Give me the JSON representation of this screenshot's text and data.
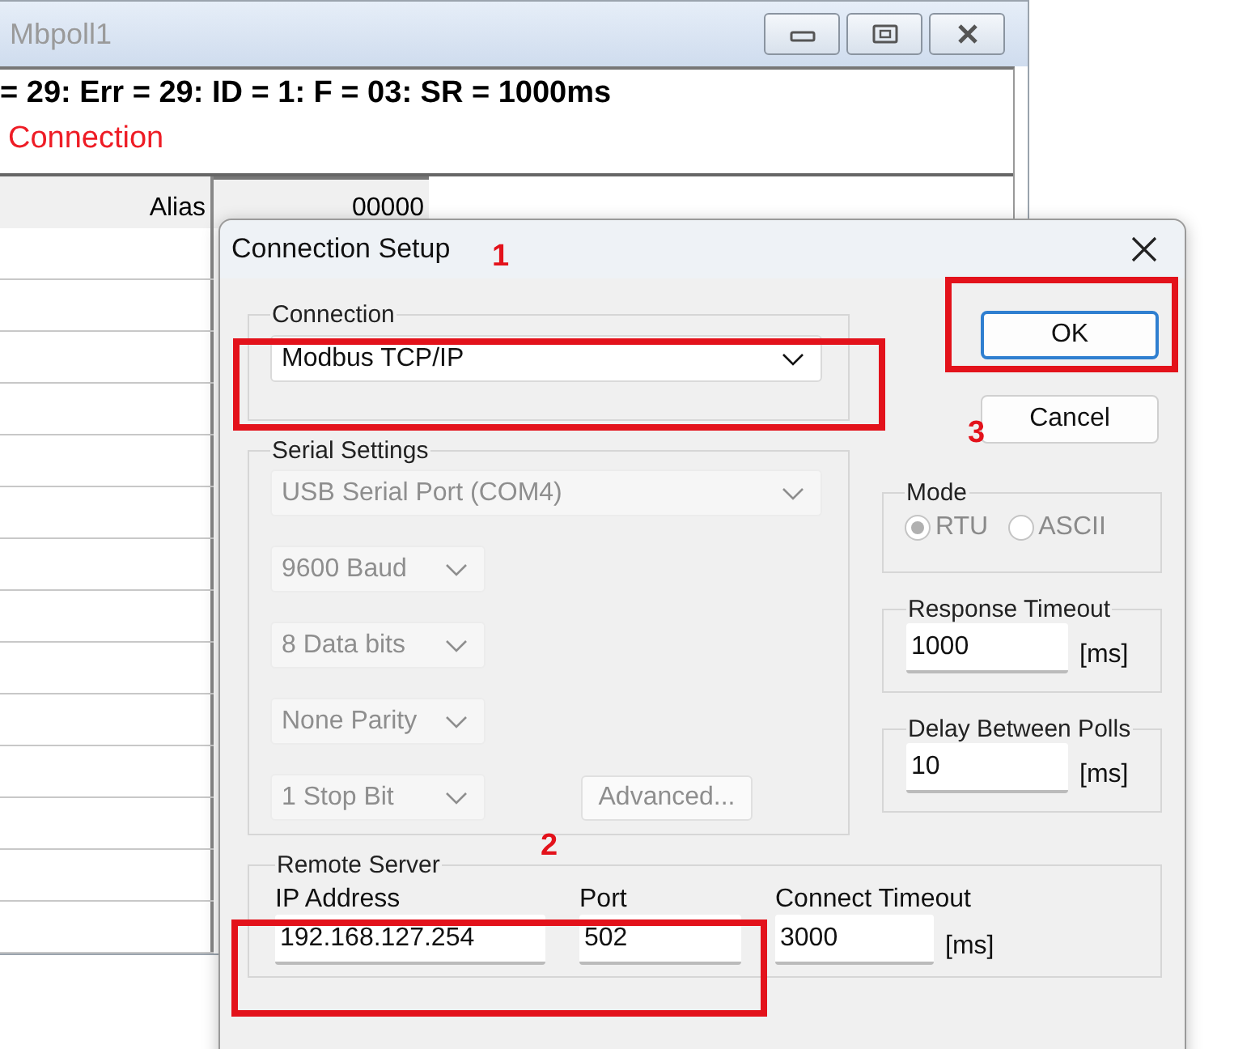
{
  "window": {
    "title": "Mbpoll1",
    "status_line": "= 29: Err = 29: ID = 1: F = 03: SR = 1000ms",
    "error_text": "Connection",
    "table": {
      "columns": [
        "Alias",
        "00000"
      ]
    }
  },
  "dialog": {
    "title": "Connection Setup",
    "connection": {
      "label": "Connection",
      "value": "Modbus TCP/IP",
      "disabled": false
    },
    "serial_settings": {
      "label": "Serial Settings",
      "selects": [
        {
          "kind": "wide",
          "value": "USB Serial Port (COM4)",
          "disabled": true
        },
        {
          "kind": "narrow",
          "value": "9600 Baud",
          "disabled": true
        },
        {
          "kind": "narrow",
          "value": "8 Data bits",
          "disabled": true
        },
        {
          "kind": "narrow",
          "value": "None Parity",
          "disabled": true
        },
        {
          "kind": "narrow",
          "value": "1 Stop Bit",
          "disabled": true
        }
      ],
      "advanced_button": {
        "label": "Advanced...",
        "disabled": true
      }
    },
    "buttons": [
      {
        "label": "OK",
        "focused": true
      },
      {
        "label": "Cancel",
        "focused": false
      }
    ],
    "mode": {
      "label": "Mode",
      "options": [
        {
          "label": "RTU",
          "selected": true,
          "disabled": true
        },
        {
          "label": "ASCII",
          "selected": false,
          "disabled": true
        }
      ]
    },
    "response_timeout": {
      "label": "Response Timeout",
      "value": "1000",
      "unit": "[ms]"
    },
    "delay_between_polls": {
      "label": "Delay Between Polls",
      "value": "10",
      "unit": "[ms]"
    },
    "remote_server": {
      "label": "Remote Server",
      "fields": [
        {
          "kind": "ip",
          "label": "IP Address",
          "value": "192.168.127.254"
        },
        {
          "kind": "port",
          "label": "Port",
          "value": "502"
        },
        {
          "kind": "timeout",
          "label": "Connect Timeout",
          "value": "3000",
          "unit": "[ms]"
        }
      ]
    }
  },
  "annotations": [
    {
      "label": "1"
    },
    {
      "label": "2"
    },
    {
      "label": "3"
    }
  ]
}
